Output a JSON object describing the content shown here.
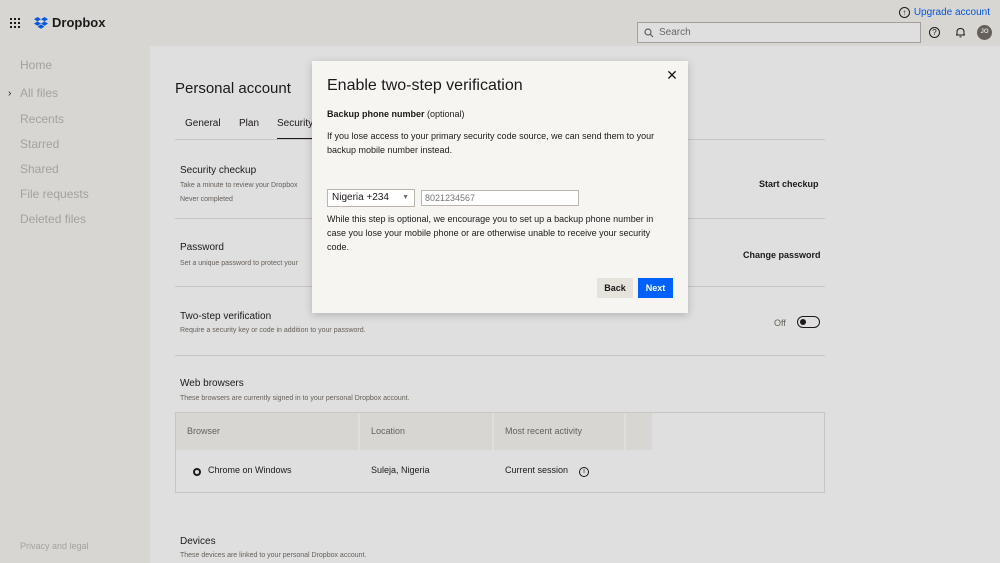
{
  "colors": {
    "accent": "#0061fe",
    "text": "#1e1919",
    "muted": "#736c64",
    "background": "#f7f5f2"
  },
  "header": {
    "brand": "Dropbox",
    "upgrade_label": "Upgrade account",
    "search_placeholder": "Search",
    "avatar_initials": "JO",
    "icons": [
      "apps-grid-icon",
      "dropbox-logo-icon",
      "upgrade-icon",
      "search-icon",
      "help-icon",
      "bell-icon"
    ]
  },
  "sidebar": {
    "items": [
      {
        "label": "Home"
      },
      {
        "label": "All files"
      },
      {
        "label": "Recents"
      },
      {
        "label": "Starred"
      },
      {
        "label": "Shared"
      },
      {
        "label": "File requests"
      },
      {
        "label": "Deleted files"
      }
    ],
    "footer": "Privacy and legal"
  },
  "main": {
    "title": "Personal account",
    "tabs": [
      {
        "label": "General"
      },
      {
        "label": "Plan"
      },
      {
        "label": "Security"
      }
    ],
    "sections": {
      "checkup": {
        "title": "Security checkup",
        "desc": "Take a minute to review your Dropbox",
        "status": "Never completed",
        "action": "Start checkup"
      },
      "password": {
        "title": "Password",
        "desc": "Set a unique password to protect your",
        "action": "Change password"
      },
      "two_step": {
        "title": "Two-step verification",
        "desc": "Require a security key or code in addition to your password.",
        "state": "Off"
      },
      "browsers": {
        "title": "Web browsers",
        "desc": "These browsers are currently signed in to your personal Dropbox account.",
        "columns": [
          "Browser",
          "Location",
          "Most recent activity"
        ],
        "rows": [
          {
            "browser": "Chrome on Windows",
            "location": "Suleja, Nigeria",
            "activity": "Current session"
          }
        ]
      },
      "devices": {
        "title": "Devices",
        "desc": "These devices are linked to your personal Dropbox account."
      }
    }
  },
  "modal": {
    "title": "Enable two-step verification",
    "subtitle_bold": "Backup phone number",
    "subtitle_rest": " (optional)",
    "intro": "If you lose access to your primary security code source, we can send them to your backup mobile number instead.",
    "country": "Nigeria +234",
    "phone_placeholder": "8021234567",
    "note": "While this step is optional, we encourage you to set up a backup phone number in case you lose your mobile phone or are otherwise unable to receive your security code.",
    "back_label": "Back",
    "next_label": "Next"
  }
}
